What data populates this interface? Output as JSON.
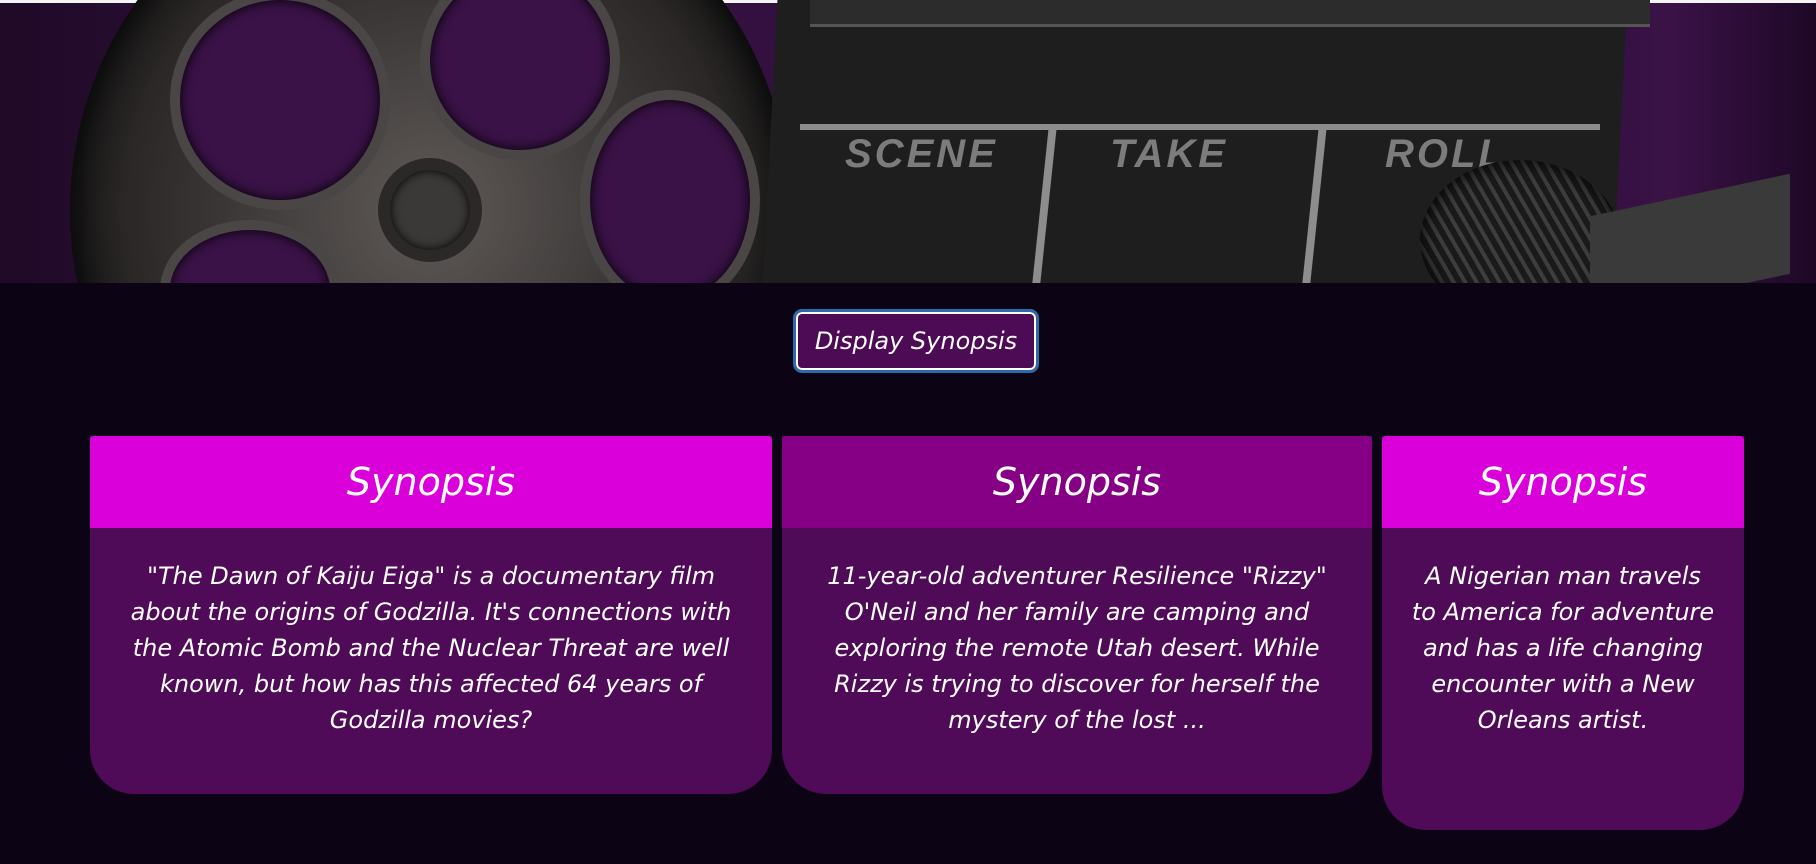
{
  "colors": {
    "page_bg": "#0c0414",
    "card_body": "#4f0b57",
    "card_head_bright": "#da00da",
    "card_head_dark": "#850085",
    "button_bg": "#4d0a55",
    "button_focus": "#2f6aa8"
  },
  "hero": {
    "clapperboard_labels": [
      "SCENE",
      "TAKE",
      "ROLL"
    ]
  },
  "button": {
    "label": "Display Synopsis"
  },
  "cards": [
    {
      "title": "Synopsis",
      "text": "\"The Dawn of Kaiju Eiga\" is a documentary film about the origins of Godzilla. It's connections with the Atomic Bomb and the Nuclear Threat are well known, but how has this affected 64 years of Godzilla movies?"
    },
    {
      "title": "Synopsis",
      "text": "11-year-old adventurer Resilience \"Rizzy\" O'Neil and her family are camping and exploring the remote Utah desert. While Rizzy is trying to discover for herself the mystery of the lost ..."
    },
    {
      "title": "Synopsis",
      "text": "A Nigerian man travels to America for adventure and has a life changing encounter with a New Orleans artist."
    }
  ]
}
